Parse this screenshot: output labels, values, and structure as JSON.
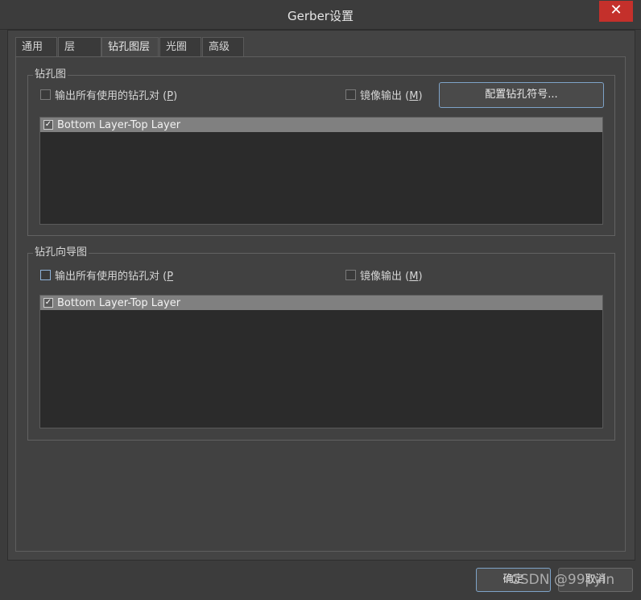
{
  "window": {
    "title": "Gerber设置",
    "close_glyph": "✕"
  },
  "tabs": [
    {
      "label": "通用"
    },
    {
      "label": "层"
    },
    {
      "label": "钻孔图层"
    },
    {
      "label": "光圈"
    },
    {
      "label": "高级"
    }
  ],
  "drill_drawing": {
    "legend": "钻孔图",
    "output_all_pairs": {
      "text": "输出所有使用的钻孔对 (",
      "mnemonic": "P",
      "suffix": ")",
      "checked": false
    },
    "mirror_output": {
      "text": "镜像输出 (",
      "mnemonic": "M",
      "suffix": ")",
      "checked": false
    },
    "config_button": "配置钻孔符号...",
    "layer_pairs": [
      {
        "label": "Bottom Layer-Top Layer",
        "checked": true
      }
    ]
  },
  "drill_guide": {
    "legend": "钻孔向导图",
    "output_all_pairs": {
      "text": "输出所有使用的钻孔对 (",
      "mnemonic": "P",
      "suffix": "",
      "checked": false
    },
    "mirror_output": {
      "text": "镜像输出 (",
      "mnemonic": "M",
      "suffix": ")",
      "checked": false
    },
    "layer_pairs": [
      {
        "label": "Bottom Layer-Top Layer",
        "checked": true
      }
    ]
  },
  "footer": {
    "ok_label": "确定",
    "cancel_label": "取消"
  },
  "watermark": "CSDN @99pyIn"
}
